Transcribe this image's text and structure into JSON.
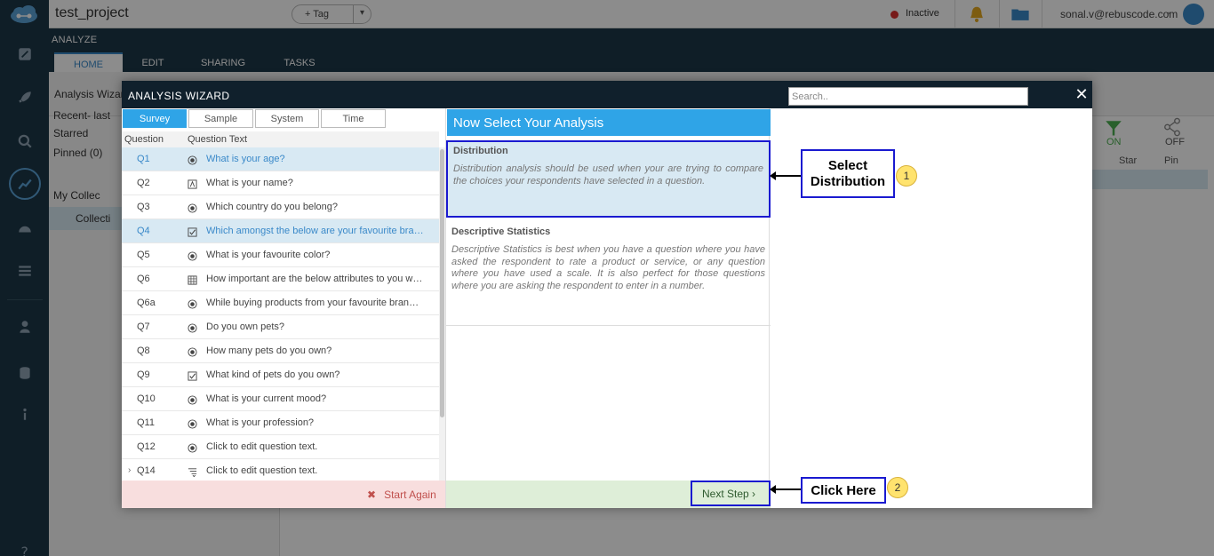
{
  "app": {
    "project_title": "test_project",
    "tag_label": "+ Tag",
    "status": "Inactive",
    "user_email": "sonal.v@rebuscode.com",
    "section_label": "ANALYZE",
    "main_tabs": [
      "HOME",
      "EDIT",
      "SHARING",
      "TASKS"
    ]
  },
  "background": {
    "analysis_wizard_label": "Analysis Wizard",
    "recent_label": "Recent- last",
    "starred_label": "Starred",
    "pinned_label": "Pinned (0)",
    "my_collections_label": "My Collec",
    "collection_label": "Collecti",
    "on_label": "ON",
    "off_label": "OFF",
    "col_star": "Star",
    "col_pin": "Pin"
  },
  "wizard": {
    "title": "ANALYSIS WIZARD",
    "search_placeholder": "Search..",
    "close_symbol": "✕",
    "tabs": [
      "Survey",
      "Sample",
      "System",
      "Time"
    ],
    "col_question": "Question",
    "col_question_text": "Question Text",
    "questions": [
      {
        "id": "Q1",
        "text": "What is your age?",
        "icon": "radio-icon",
        "selected": true
      },
      {
        "id": "Q2",
        "text": "What is your name?",
        "icon": "text-icon",
        "selected": false
      },
      {
        "id": "Q3",
        "text": "Which country do you belong?",
        "icon": "radio-icon",
        "selected": false
      },
      {
        "id": "Q4",
        "text": "Which amongst the below are your favourite brands?",
        "icon": "checkbox-icon",
        "selected": true
      },
      {
        "id": "Q5",
        "text": "What is your favourite color?",
        "icon": "radio-icon",
        "selected": false
      },
      {
        "id": "Q6",
        "text": "How important are the below attributes to you when buying",
        "icon": "grid-icon",
        "selected": false
      },
      {
        "id": "Q6a",
        "text": "While buying products from your favourite brand, what",
        "icon": "radio-icon",
        "selected": false
      },
      {
        "id": "Q7",
        "text": "Do you own pets?",
        "icon": "radio-icon",
        "selected": false
      },
      {
        "id": "Q8",
        "text": "How many pets do you own?",
        "icon": "radio-icon",
        "selected": false
      },
      {
        "id": "Q9",
        "text": "What kind of pets do you own?",
        "icon": "checkbox-icon",
        "selected": false
      },
      {
        "id": "Q10",
        "text": "What is your current mood?",
        "icon": "radio-icon",
        "selected": false
      },
      {
        "id": "Q11",
        "text": "What is your profession?",
        "icon": "radio-icon",
        "selected": false
      },
      {
        "id": "Q12",
        "text": "Click to edit question text.",
        "icon": "radio-icon",
        "selected": false
      },
      {
        "id": "Q14",
        "text": "Click to edit question text.",
        "icon": "list-icon",
        "selected": false,
        "expandable": true
      }
    ],
    "start_again": "Start Again",
    "analysis_header": "Now Select Your Analysis",
    "analyses": [
      {
        "title": "Distribution",
        "desc": "Distribution analysis should be used when your are trying to compare the choices your respondents have selected in a question."
      },
      {
        "title": "Descriptive Statistics",
        "desc": "Descriptive Statistics is best when you have a question where you have asked the respondent to rate a product or service, or any question where you have used a scale. It is also perfect for those questions where you are asking the respondent to enter in a number."
      }
    ],
    "next_step": "Next Step ›"
  },
  "annotations": {
    "callout1_text": "Select Distribution",
    "callout1_badge": "1",
    "callout2_text": "Click Here",
    "callout2_badge": "2"
  }
}
